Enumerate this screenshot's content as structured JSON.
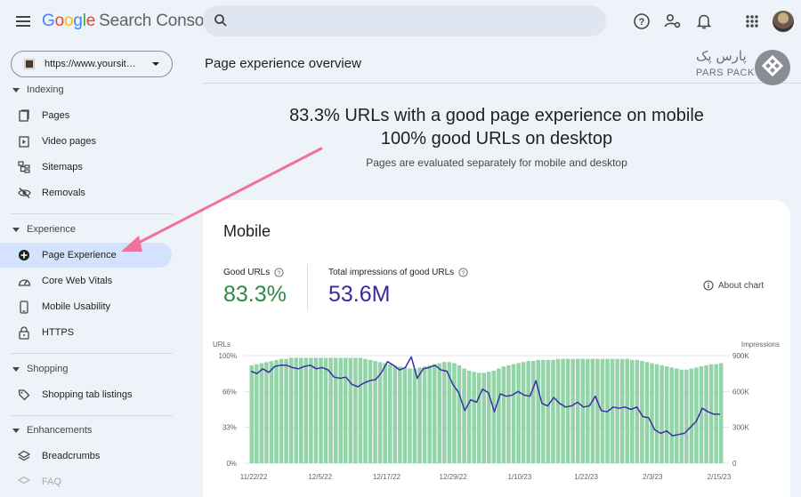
{
  "app": {
    "logo_letters": [
      "G",
      "o",
      "o",
      "g",
      "l",
      "e"
    ],
    "product": "Search Console",
    "search_placeholder": ""
  },
  "icons": {
    "menu": "menu-icon",
    "search": "search-icon",
    "help": "help-icon",
    "users": "manage-users-icon",
    "bell": "notifications-icon",
    "apps": "apps-grid-icon"
  },
  "property": {
    "url": "https://www.yoursit…"
  },
  "sidebar": {
    "indexing": {
      "label": "Indexing",
      "items": [
        {
          "label": "Pages",
          "icon": "pages-icon"
        },
        {
          "label": "Video pages",
          "icon": "video-pages-icon"
        },
        {
          "label": "Sitemaps",
          "icon": "sitemaps-icon"
        },
        {
          "label": "Removals",
          "icon": "removals-icon"
        }
      ]
    },
    "experience": {
      "label": "Experience",
      "items": [
        {
          "label": "Page Experience",
          "icon": "page-experience-icon",
          "active": true
        },
        {
          "label": "Core Web Vitals",
          "icon": "core-web-vitals-icon"
        },
        {
          "label": "Mobile Usability",
          "icon": "mobile-icon"
        },
        {
          "label": "HTTPS",
          "icon": "lock-icon"
        }
      ]
    },
    "shopping": {
      "label": "Shopping",
      "items": [
        {
          "label": "Shopping tab listings",
          "icon": "tag-icon"
        }
      ]
    },
    "enhancements": {
      "label": "Enhancements",
      "items": [
        {
          "label": "Breadcrumbs",
          "icon": "layers-icon"
        },
        {
          "label": "FAQ",
          "icon": "faq-icon"
        }
      ]
    }
  },
  "main": {
    "page_title": "Page experience overview",
    "brand_fa": "پارس پک",
    "brand_en": "PARS PACK",
    "headline_1": "83.3% URLs with a good page experience on mobile",
    "headline_2": "100% good URLs on desktop",
    "subline": "Pages are evaluated separately for mobile and desktop",
    "card": {
      "title": "Mobile",
      "good_urls_label": "Good URLs",
      "good_urls_value": "83.3%",
      "impressions_label": "Total impressions of good URLs",
      "impressions_value": "53.6M",
      "about_chart": "About chart"
    }
  },
  "colors": {
    "accent_green": "#2e8b47",
    "accent_purple": "#3b2aa0",
    "bar_green": "#93d5a8",
    "line_purple": "#3f2fa6",
    "active_nav": "#d3e3fd",
    "arrow_pink": "#f0729a"
  },
  "chart_data": {
    "type": "bar",
    "left_axis_title": "URLs",
    "right_axis_title": "Impressions",
    "y_ticks": [
      "100%",
      "66%",
      "33%",
      "0%"
    ],
    "y2_ticks": [
      "900K",
      "600K",
      "300K",
      "0"
    ],
    "x_ticks": [
      "11/22/22",
      "12/5/22",
      "12/17/22",
      "12/29/22",
      "1/10/23",
      "1/22/23",
      "2/3/23",
      "2/15/23"
    ],
    "ylim": [
      0,
      100
    ],
    "y2lim": [
      0,
      900000
    ],
    "series": [
      {
        "name": "Good URLs",
        "axis": "left",
        "values": [
          91,
          92,
          93,
          94,
          95,
          96,
          97,
          97,
          98,
          98,
          98,
          98,
          98,
          98,
          98,
          98,
          98,
          98,
          98,
          98,
          98,
          98,
          98,
          97,
          96,
          95,
          94,
          93,
          92,
          91,
          90,
          89,
          88,
          88,
          89,
          90,
          91,
          92,
          93,
          94,
          94,
          93,
          91,
          88,
          86,
          85,
          84,
          84,
          85,
          86,
          88,
          90,
          91,
          92,
          93,
          94,
          95,
          95,
          96,
          96,
          96,
          96,
          97,
          97,
          97,
          97,
          97,
          97,
          97,
          97,
          97,
          97,
          97,
          97,
          97,
          97,
          97,
          96,
          96,
          95,
          94,
          93,
          92,
          91,
          90,
          89,
          88,
          87,
          87,
          88,
          89,
          90,
          91,
          92,
          92,
          93
        ]
      },
      {
        "name": "Impressions of good URLs",
        "axis": "right",
        "type": "line",
        "values": [
          770000,
          750000,
          790000,
          760000,
          810000,
          820000,
          820000,
          800000,
          790000,
          810000,
          820000,
          790000,
          800000,
          780000,
          720000,
          710000,
          720000,
          660000,
          640000,
          670000,
          690000,
          700000,
          760000,
          850000,
          820000,
          780000,
          800000,
          890000,
          710000,
          790000,
          800000,
          820000,
          780000,
          770000,
          660000,
          590000,
          440000,
          530000,
          510000,
          620000,
          590000,
          430000,
          580000,
          560000,
          570000,
          600000,
          570000,
          560000,
          690000,
          500000,
          480000,
          550000,
          500000,
          470000,
          480000,
          510000,
          470000,
          480000,
          560000,
          440000,
          430000,
          470000,
          460000,
          470000,
          450000,
          470000,
          390000,
          380000,
          280000,
          250000,
          270000,
          230000,
          240000,
          250000,
          300000,
          350000,
          460000,
          430000,
          410000,
          410000
        ]
      }
    ]
  }
}
